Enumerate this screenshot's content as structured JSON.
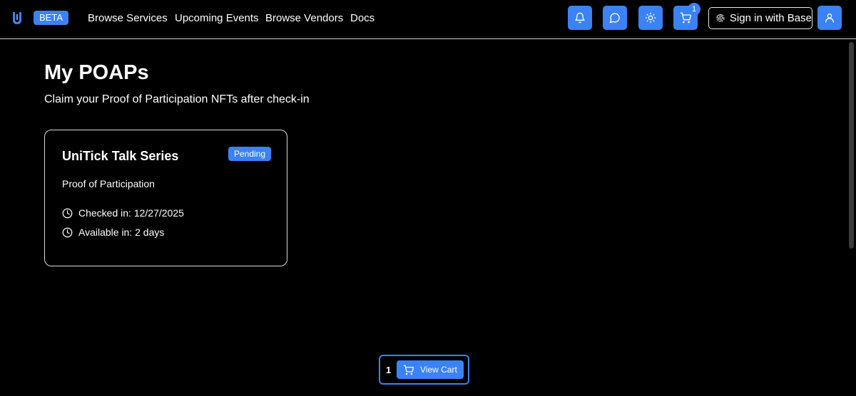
{
  "header": {
    "beta_label": "BETA",
    "nav": [
      "Browse Services",
      "Upcoming Events",
      "Browse Vendors",
      "Docs"
    ],
    "cart_count": "1",
    "signin_label": "Sign in with Base",
    "icons": [
      "bell-icon",
      "chat-icon",
      "sun-icon",
      "cart-icon",
      "fingerprint-icon",
      "user-icon"
    ]
  },
  "main": {
    "title": "My POAPs",
    "subtitle": "Claim your Proof of Participation NFTs after check-in",
    "cards": [
      {
        "title": "UniTick Talk Series",
        "status": "Pending",
        "description": "Proof of Participation",
        "checked_in": "Checked in: 12/27/2025",
        "available_in": "Available in: 2 days"
      }
    ]
  },
  "cart_bar": {
    "count": "1",
    "button_label": "View Cart"
  },
  "colors": {
    "accent": "#3b82f6",
    "background": "#000000",
    "text": "#ffffff"
  }
}
